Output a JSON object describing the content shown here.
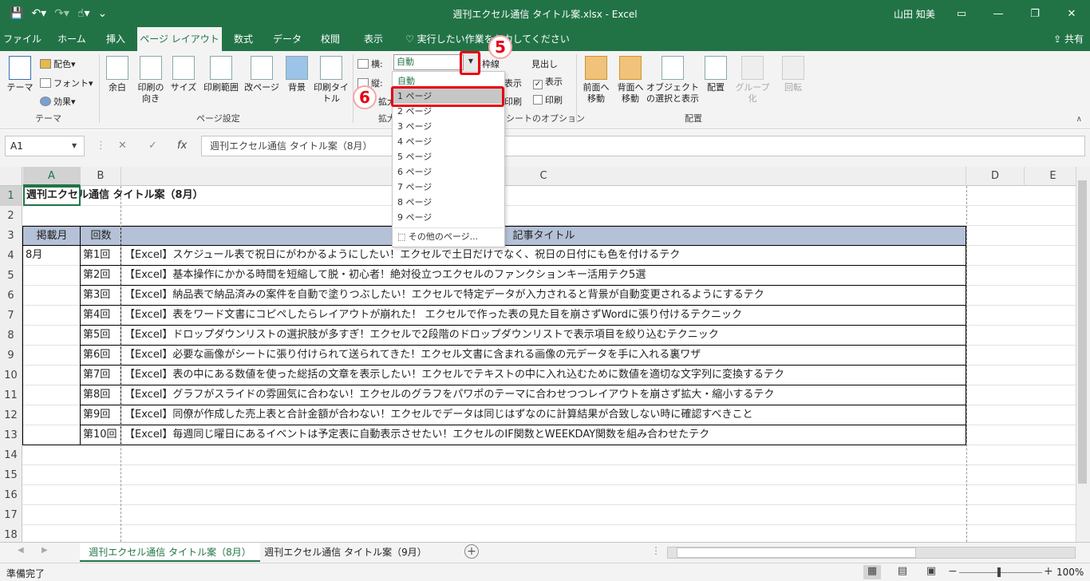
{
  "titlebar": {
    "doc_title": "週刊エクセル通信 タイトル案.xlsx - Excel",
    "user_name": "山田 知美",
    "qat": [
      "save-icon",
      "undo-icon",
      "redo-icon",
      "touch-mode-icon",
      "customize-icon"
    ]
  },
  "tabs": [
    {
      "label": "ファイル"
    },
    {
      "label": "ホーム"
    },
    {
      "label": "挿入"
    },
    {
      "label": "ページ レイアウト",
      "active": true
    },
    {
      "label": "数式"
    },
    {
      "label": "データ"
    },
    {
      "label": "校閲"
    },
    {
      "label": "表示"
    }
  ],
  "tell_me": "実行したい作業を入力してください",
  "share": "共有",
  "ribbon": {
    "theme_group": {
      "label": "テーマ",
      "theme_btn": "テーマ",
      "colors": "配色",
      "fonts": "フォント",
      "effects": "効果"
    },
    "page_setup": {
      "label": "ページ設定",
      "margins": "余白",
      "orientation": "印刷の向き",
      "size": "サイズ",
      "print_area": "印刷範囲",
      "breaks": "改ページ",
      "background": "背景",
      "print_titles": "印刷タイトル"
    },
    "scale": {
      "label": "拡大縮小印刷",
      "width_label": "横:",
      "width_value": "自動",
      "height_label": "縦:",
      "scale_label": "拡大"
    },
    "sheet_options": {
      "label": "シートのオプション",
      "gridlines": "枠線",
      "headings": "見出し",
      "view": "表示",
      "print": "印刷",
      "view_partial": "表示",
      "print_partial": "印刷"
    },
    "arrange": {
      "label": "配置",
      "bring_forward": "前面へ移動",
      "send_backward": "背面へ移動",
      "selection_pane": "オブジェクトの選択と表示",
      "align": "配置",
      "group": "グループ化",
      "rotate": "回転"
    }
  },
  "scale_dropdown": {
    "items": [
      "自動",
      "1 ページ",
      "2 ページ",
      "3 ページ",
      "4 ページ",
      "5 ページ",
      "6 ページ",
      "7 ページ",
      "8 ページ",
      "9 ページ"
    ],
    "other": "その他のページ..."
  },
  "callouts": {
    "step5": "5",
    "step6": "6"
  },
  "formula_bar": {
    "name_box": "A1",
    "cancel": "✕",
    "enter": "✓",
    "fx": "fx",
    "content": "週刊エクセル通信 タイトル案（8月）"
  },
  "columns": [
    "A",
    "B",
    "C",
    "D",
    "E"
  ],
  "row_numbers": [
    "1",
    "2",
    "3",
    "4",
    "5",
    "6",
    "7",
    "8",
    "9",
    "10",
    "11",
    "12",
    "13",
    "14",
    "15",
    "16",
    "17",
    "18"
  ],
  "sheet": {
    "title": "週刊エクセル通信 タイトル案（8月）",
    "header": {
      "month": "掲載月",
      "issue": "回数",
      "title": "記事タイトル"
    },
    "month_value": "8月",
    "rows": [
      {
        "issue": "第1回",
        "title": "【Excel】スケジュール表で祝日にがわかるようにしたい！エクセルで土日だけでなく、祝日の日付にも色を付けるテク"
      },
      {
        "issue": "第2回",
        "title": "【Excel】基本操作にかかる時間を短縮して脱・初心者！絶対役立つエクセルのファンクションキー活用テク5選"
      },
      {
        "issue": "第3回",
        "title": "【Excel】納品表で納品済みの案件を自動で塗りつぶしたい！エクセルで特定データが入力されると背景が自動変更されるようにするテク"
      },
      {
        "issue": "第4回",
        "title": "【Excel】表をワード文書にコピペしたらレイアウトが崩れた！ エクセルで作った表の見た目を崩さずWordに張り付けるテクニック"
      },
      {
        "issue": "第5回",
        "title": "【Excel】ドロップダウンリストの選択肢が多すぎ！エクセルで2段階のドロップダウンリストで表示項目を絞り込むテクニック"
      },
      {
        "issue": "第6回",
        "title": "【Excel】必要な画像がシートに張り付けられて送られてきた！エクセル文書に含まれる画像の元データを手に入れる裏ワザ"
      },
      {
        "issue": "第7回",
        "title": "【Excel】表の中にある数値を使った総括の文章を表示したい！エクセルでテキストの中に入れ込むために数値を適切な文字列に変換するテク"
      },
      {
        "issue": "第8回",
        "title": "【Excel】グラフがスライドの雰囲気に合わない！エクセルのグラフをパワポのテーマに合わせつつレイアウトを崩さず拡大・縮小するテク"
      },
      {
        "issue": "第9回",
        "title": "【Excel】同僚が作成した売上表と合計金額が合わない！エクセルでデータは同じはずなのに計算結果が合致しない時に確認すべきこと"
      },
      {
        "issue": "第10回",
        "title": "【Excel】毎週同じ曜日にあるイベントは予定表に自動表示させたい！エクセルのIF関数とWEEKDAY関数を組み合わせたテク"
      }
    ]
  },
  "sheet_tabs": [
    {
      "label": "週刊エクセル通信 タイトル案（8月）",
      "active": true
    },
    {
      "label": "週刊エクセル通信 タイトル案（9月）"
    }
  ],
  "status": {
    "text": "準備完了",
    "zoom": "100%"
  }
}
